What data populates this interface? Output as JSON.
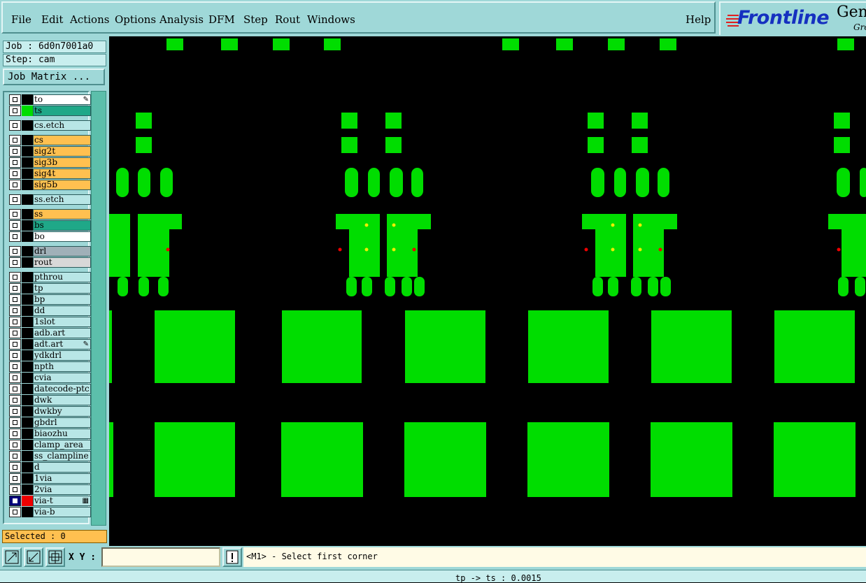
{
  "menu": {
    "items": [
      {
        "label": "File"
      },
      {
        "label": "Edit"
      },
      {
        "label": "Actions"
      },
      {
        "label": "Options"
      },
      {
        "label": "Analysis"
      },
      {
        "label": "DFM"
      },
      {
        "label": "Step"
      },
      {
        "label": "Rout"
      },
      {
        "label": "Windows"
      }
    ],
    "help": "Help"
  },
  "logo": {
    "brand": "Frontline",
    "product": "Gen",
    "sub": "Gro"
  },
  "panel": {
    "job": "Job : 6d0n7001a0",
    "step": "Step: cam",
    "matrix_button": "Job Matrix ...",
    "selected": "Selected : 0"
  },
  "layers": [
    {
      "name": "to",
      "bg": "#ffffff",
      "swatch": "#000000",
      "mark": "✎",
      "gap": 0
    },
    {
      "name": "ts",
      "bg": "#1fa888",
      "swatch": "#00dd00",
      "gap": 0
    },
    {
      "name": "cs.etch",
      "bg": "#b8e6e6",
      "swatch": "#000000",
      "gap": 1
    },
    {
      "name": "cs",
      "bg": "#ffc050",
      "swatch": "#000000",
      "gap": 1
    },
    {
      "name": "sig2t",
      "bg": "#ffc050",
      "swatch": "#000000",
      "gap": 0
    },
    {
      "name": "sig3b",
      "bg": "#ffc050",
      "swatch": "#000000",
      "gap": 0
    },
    {
      "name": "sig4t",
      "bg": "#ffc050",
      "swatch": "#000000",
      "gap": 0
    },
    {
      "name": "sig5b",
      "bg": "#ffc050",
      "swatch": "#000000",
      "gap": 0
    },
    {
      "name": "ss.etch",
      "bg": "#b8e6e6",
      "swatch": "#000000",
      "gap": 1
    },
    {
      "name": "ss",
      "bg": "#ffc050",
      "swatch": "#000000",
      "gap": 1
    },
    {
      "name": "bs",
      "bg": "#1fa888",
      "swatch": "#000000",
      "gap": 0
    },
    {
      "name": "bo",
      "bg": "#ffffff",
      "swatch": "#000000",
      "gap": 0
    },
    {
      "name": "drl",
      "bg": "#a0b0b8",
      "swatch": "#000000",
      "gap": 1
    },
    {
      "name": "rout",
      "bg": "#d8d8d8",
      "swatch": "#000000",
      "gap": 0
    },
    {
      "name": "pthrou",
      "bg": "#b8e6e6",
      "swatch": "#000000",
      "gap": 1
    },
    {
      "name": "tp",
      "bg": "#b8e6e6",
      "swatch": "#000000",
      "gap": 0
    },
    {
      "name": "bp",
      "bg": "#b8e6e6",
      "swatch": "#000000",
      "gap": 0
    },
    {
      "name": "dd",
      "bg": "#b8e6e6",
      "swatch": "#000000",
      "gap": 0
    },
    {
      "name": "1slot",
      "bg": "#b8e6e6",
      "swatch": "#000000",
      "gap": 0
    },
    {
      "name": "adb.art",
      "bg": "#b8e6e6",
      "swatch": "#000000",
      "gap": 0
    },
    {
      "name": "adt.art",
      "bg": "#b8e6e6",
      "swatch": "#000000",
      "mark": "✎",
      "gap": 0
    },
    {
      "name": "ydkdrl",
      "bg": "#b8e6e6",
      "swatch": "#000000",
      "gap": 0
    },
    {
      "name": "npth",
      "bg": "#b8e6e6",
      "swatch": "#000000",
      "gap": 0
    },
    {
      "name": "cvia",
      "bg": "#b8e6e6",
      "swatch": "#000000",
      "gap": 0
    },
    {
      "name": "datecode-ptc",
      "bg": "#b8e6e6",
      "swatch": "#000000",
      "gap": 0
    },
    {
      "name": "dwk",
      "bg": "#b8e6e6",
      "swatch": "#000000",
      "gap": 0
    },
    {
      "name": "dwkby",
      "bg": "#b8e6e6",
      "swatch": "#000000",
      "gap": 0
    },
    {
      "name": "gbdrl",
      "bg": "#b8e6e6",
      "swatch": "#000000",
      "gap": 0
    },
    {
      "name": "biaozhu",
      "bg": "#b8e6e6",
      "swatch": "#000000",
      "gap": 0
    },
    {
      "name": "clamp_area",
      "bg": "#b8e6e6",
      "swatch": "#000000",
      "gap": 0
    },
    {
      "name": "ss_clampline",
      "bg": "#b8e6e6",
      "swatch": "#000000",
      "gap": 0
    },
    {
      "name": "d",
      "bg": "#b8e6e6",
      "swatch": "#000000",
      "gap": 0
    },
    {
      "name": "1via",
      "bg": "#b8e6e6",
      "swatch": "#000000",
      "gap": 0
    },
    {
      "name": "2via",
      "bg": "#b8e6e6",
      "swatch": "#000000",
      "gap": 0
    },
    {
      "name": "via-t",
      "bg": "#b8e6e6",
      "swatch": "#ee0000",
      "mark": "▦",
      "filled": true,
      "gap": 0
    },
    {
      "name": "via-b",
      "bg": "#b8e6e6",
      "swatch": "#000000",
      "gap": 0
    }
  ],
  "canvas": {
    "pad_color": "#00dd00",
    "drill_color": "#ee0000",
    "via_color": "#eeee00"
  },
  "bottom": {
    "xy_label": "X Y :",
    "xy_value": "",
    "prompt": "<M1> - Select first corner",
    "status": "tp -> ts : 0.0015"
  }
}
